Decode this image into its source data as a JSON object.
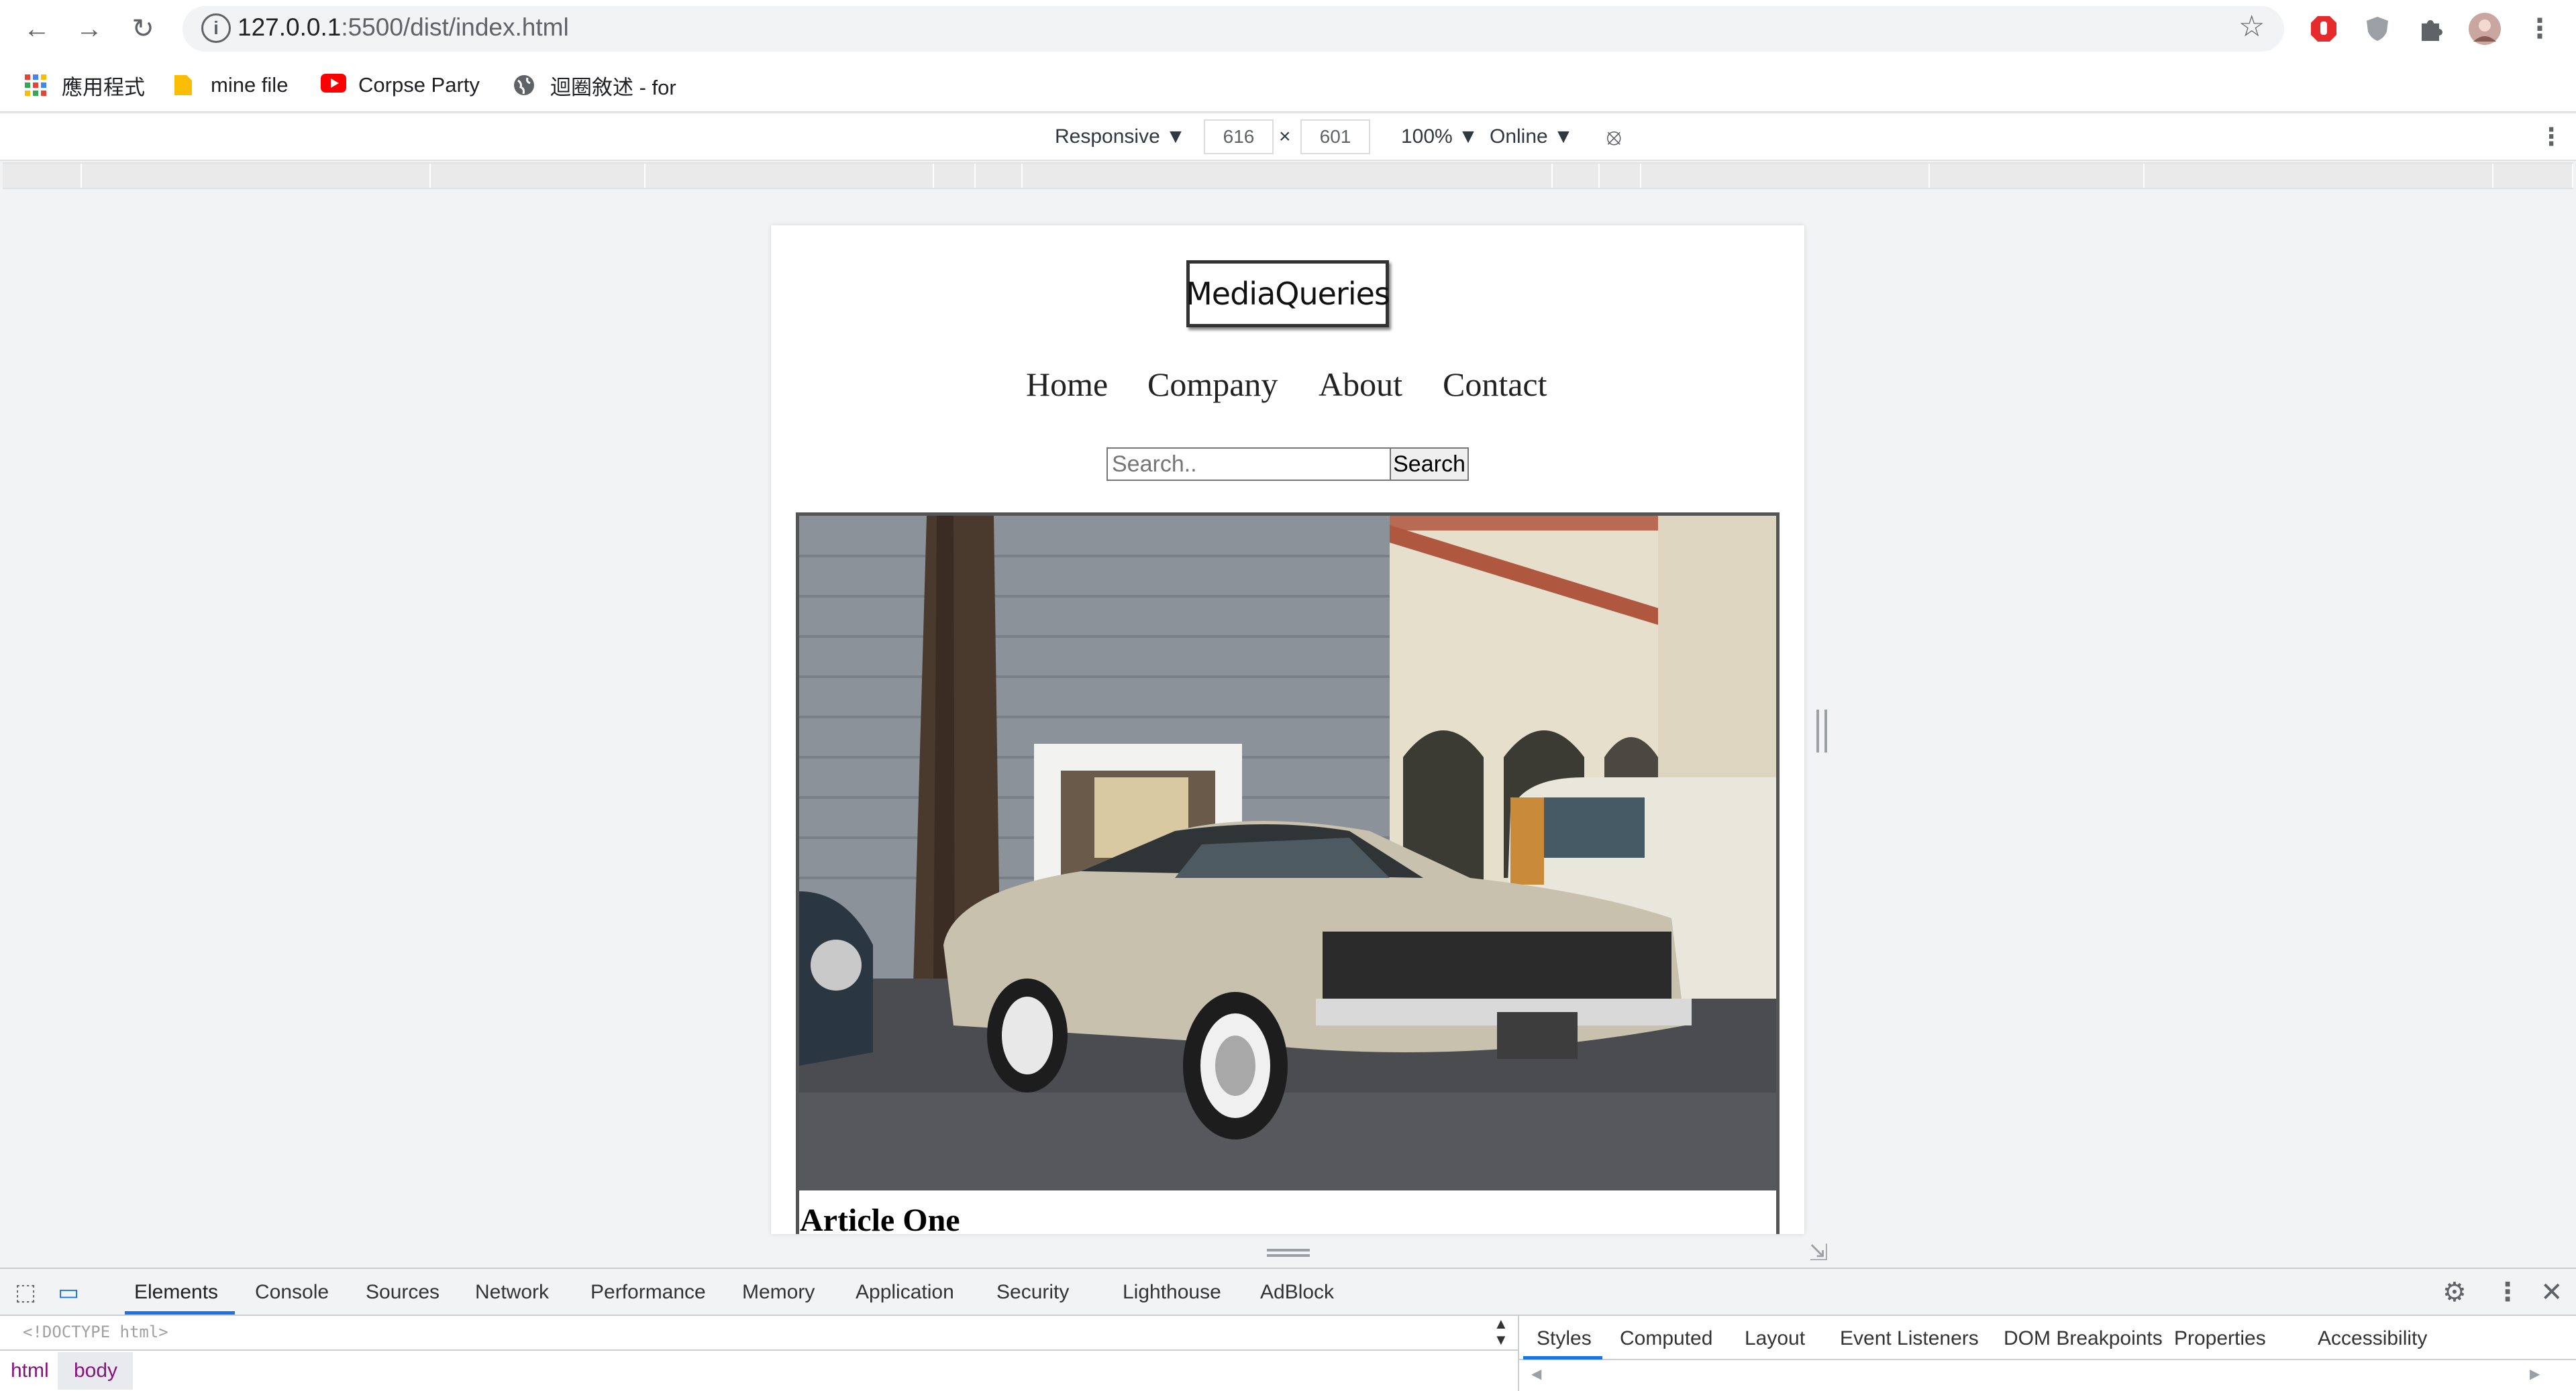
{
  "browser": {
    "url_host": "127.0.0.1",
    "url_path": ":5500/dist/index.html",
    "bookmarks": [
      {
        "label": "應用程式",
        "icon": "apps-grid-icon"
      },
      {
        "label": "mine file",
        "icon": "folder-icon"
      },
      {
        "label": "Corpse Party",
        "icon": "youtube-icon"
      },
      {
        "label": "迴圈敘述 - for",
        "icon": "globe-icon"
      }
    ]
  },
  "device_toolbar": {
    "mode": "Responsive",
    "width": "616",
    "times": "×",
    "height": "601",
    "zoom": "100%",
    "network": "Online"
  },
  "page": {
    "logo": "MediaQueries",
    "nav": [
      "Home",
      "Company",
      "About",
      "Contact"
    ],
    "search_placeholder": "Search..",
    "search_button": "Search",
    "article_title": "Article One"
  },
  "devtools": {
    "tabs": [
      "Elements",
      "Console",
      "Sources",
      "Network",
      "Performance",
      "Memory",
      "Application",
      "Security",
      "Lighthouse",
      "AdBlock"
    ],
    "active_tab": "Elements",
    "doctype": "<!DOCTYPE html>",
    "breadcrumbs": [
      "html",
      "body"
    ],
    "styles_tabs": [
      "Styles",
      "Computed",
      "Layout",
      "Event Listeners",
      "DOM Breakpoints",
      "Properties",
      "Accessibility"
    ]
  },
  "colors": {
    "accent": "#1a73e8",
    "tag": "#881280"
  }
}
